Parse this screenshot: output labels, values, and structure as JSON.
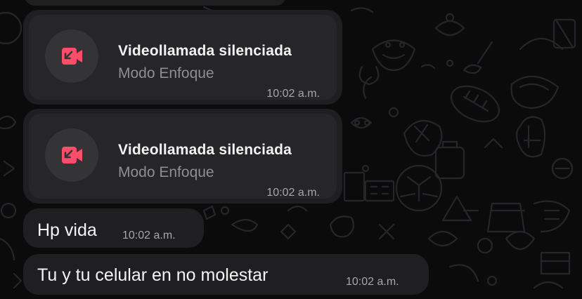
{
  "messages": [
    {
      "type": "call",
      "title": "Videollamada silenciada",
      "subtitle": "Modo Enfoque",
      "time": "10:02 a.m.",
      "icon": "missed-video-call-icon",
      "icon_color": "#ff4d6a"
    },
    {
      "type": "call",
      "title": "Videollamada silenciada",
      "subtitle": "Modo Enfoque",
      "time": "10:02 a.m.",
      "icon": "missed-video-call-icon",
      "icon_color": "#ff4d6a"
    },
    {
      "type": "text",
      "text": "Hp vida",
      "time": "10:02 a.m."
    },
    {
      "type": "text",
      "text": "Tu y tu celular en no molestar",
      "time": "10:02 a.m."
    }
  ],
  "colors": {
    "background": "#0b0b0c",
    "bubble": "#1f1f21",
    "accent": "#ff4d6a"
  }
}
